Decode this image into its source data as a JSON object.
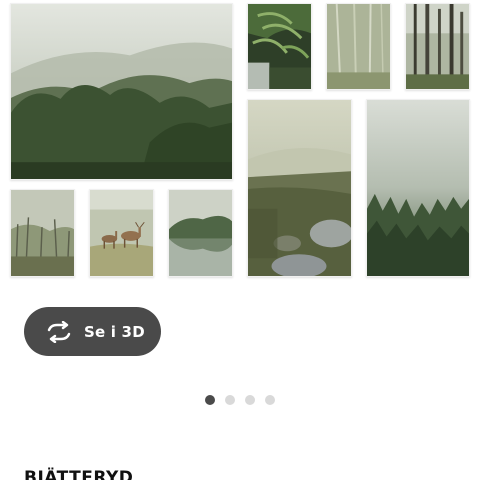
{
  "gallery": {
    "photos": [
      "misty-forest-hill-photo",
      "fern-waterfall-photo",
      "misty-birch-trees-photo",
      "tall-pine-forest-photo",
      "foggy-moor-rocks-photo",
      "foggy-pine-valley-photo",
      "misty-bare-trees-photo",
      "deer-in-meadow-photo",
      "misty-lake-photo"
    ]
  },
  "view_3d_button": {
    "label": "Se i 3D",
    "icon": "rotate-arrows-icon"
  },
  "pagination": {
    "total": 4,
    "active": 1
  },
  "product": {
    "name": "BJÄTTERYD"
  },
  "colors": {
    "button_bg": "#4a4a4a",
    "dot_active": "#4a4a4a",
    "dot_inactive": "#d9d9d9"
  }
}
